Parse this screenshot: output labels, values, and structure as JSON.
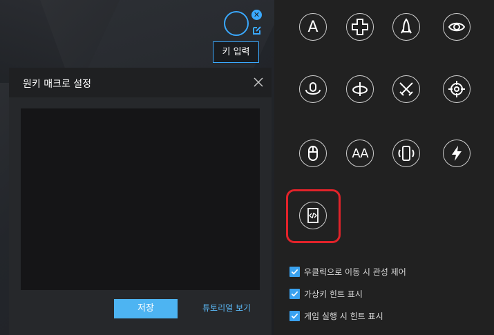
{
  "key_widget": {
    "input_button_label": "키 입력"
  },
  "macro_dialog": {
    "title": "원키 매크로 설정",
    "editor_content": "",
    "save_label": "저장",
    "tutorial_label": "튜토리얼 보기"
  },
  "toolbox": {
    "tools": [
      {
        "name": "text-key",
        "label": "A"
      },
      {
        "name": "dpad",
        "label": ""
      },
      {
        "name": "skill",
        "label": ""
      },
      {
        "name": "view",
        "label": ""
      },
      {
        "name": "rotate-mouse",
        "label": ""
      },
      {
        "name": "rotate-axis",
        "label": ""
      },
      {
        "name": "attack",
        "label": ""
      },
      {
        "name": "aim",
        "label": ""
      },
      {
        "name": "mouse",
        "label": ""
      },
      {
        "name": "repeat-key",
        "label": "AA"
      },
      {
        "name": "shake",
        "label": ""
      },
      {
        "name": "lightning",
        "label": ""
      },
      {
        "name": "macro-script",
        "label": ""
      }
    ]
  },
  "options": [
    {
      "label": "우클릭으로 이동 시 관성 제어",
      "checked": true
    },
    {
      "label": "가상키 힌트 표시",
      "checked": true
    },
    {
      "label": "게임 실행 시 힌트 표시",
      "checked": true
    }
  ],
  "colors": {
    "accent": "#3aa9ff",
    "highlight": "#e2232a",
    "save_button": "#4db4f2"
  }
}
